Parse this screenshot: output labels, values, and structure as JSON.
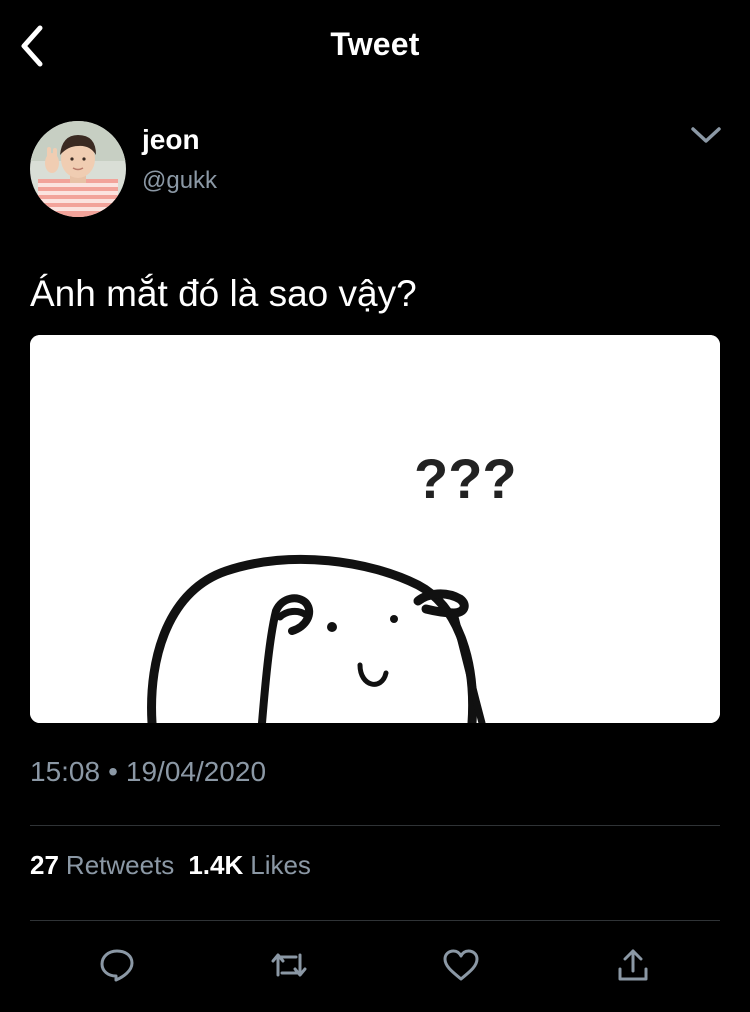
{
  "header": {
    "title": "Tweet",
    "back_icon": "chevron-left-icon"
  },
  "author": {
    "name": "jeon",
    "handle": "@gukk",
    "avatar": "user-avatar-photo"
  },
  "tweet": {
    "text": "Ánh mắt đó là sao vậy?",
    "media": {
      "kind": "image",
      "caption": "???"
    },
    "time": "15:08",
    "separator": "•",
    "date": "19/04/2020"
  },
  "stats": {
    "retweets_count": "27",
    "retweets_label": "Retweets",
    "likes_count": "1.4K",
    "likes_label": "Likes"
  },
  "actions": [
    {
      "name": "reply",
      "icon": "comment-icon"
    },
    {
      "name": "retweet",
      "icon": "retweet-icon"
    },
    {
      "name": "like",
      "icon": "heart-icon"
    },
    {
      "name": "share",
      "icon": "share-icon"
    }
  ],
  "colors": {
    "background": "#000000",
    "text_primary": "#ffffff",
    "text_secondary": "#8b98a5",
    "divider": "#2f3336"
  }
}
